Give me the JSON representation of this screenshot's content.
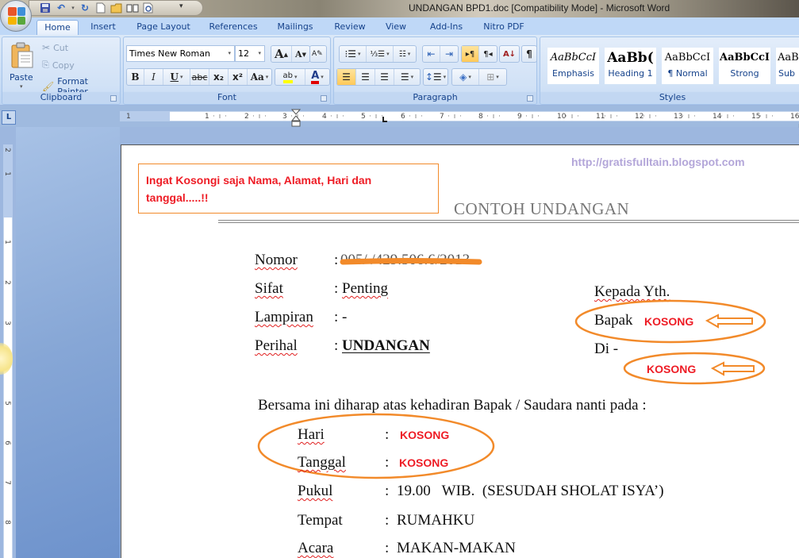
{
  "window": {
    "title": "UNDANGAN BPD1.doc [Compatibility Mode] - Microsoft Word"
  },
  "quick_access": {
    "icons": [
      "save-icon",
      "undo-icon",
      "redo-icon",
      "new-document-icon",
      "open-folder-icon",
      "open-book-icon",
      "print-preview-icon"
    ],
    "customize_label": "▾"
  },
  "tabs": [
    {
      "label": "Home",
      "active": true
    },
    {
      "label": "Insert"
    },
    {
      "label": "Page Layout"
    },
    {
      "label": "References"
    },
    {
      "label": "Mailings"
    },
    {
      "label": "Review"
    },
    {
      "label": "View"
    },
    {
      "label": "Add-Ins"
    },
    {
      "label": "Nitro PDF"
    }
  ],
  "ribbon": {
    "clipboard": {
      "label": "Clipboard",
      "paste": "Paste",
      "cut": "Cut",
      "copy": "Copy",
      "format_painter": "Format Painter"
    },
    "font": {
      "label": "Font",
      "font_name": "Times New Roman",
      "font_size": "12",
      "grow": "A",
      "shrink": "A",
      "bold": "B",
      "italic": "I",
      "underline": "U",
      "strikethrough": "abc",
      "subscript": "x₂",
      "superscript": "x²",
      "change_case": "Aa",
      "highlight": "ab",
      "font_color": "A",
      "highlight_color": "#ffff00",
      "font_color_value": "#e00000"
    },
    "paragraph": {
      "label": "Paragraph",
      "show_marks": "¶",
      "ltr": "▸¶",
      "rtl": "¶◂",
      "sort": "A↓"
    },
    "styles": {
      "label": "Styles",
      "items": [
        {
          "preview": "AaBbCcI",
          "name": "Emphasis"
        },
        {
          "preview": "AaBb(",
          "name": "Heading 1"
        },
        {
          "preview": "AaBbCcI",
          "name": "¶ Normal"
        },
        {
          "preview": "AaBbCcI",
          "name": "Strong"
        },
        {
          "preview": "AaB",
          "name": "Sub"
        }
      ]
    }
  },
  "ruler": {
    "corner": "L",
    "h_numbers": [
      "1",
      "1",
      "2",
      "3",
      "4",
      "5",
      "6",
      "7",
      "8",
      "9",
      "10",
      "11",
      "12",
      "13",
      "14",
      "15",
      "16"
    ],
    "v_numbers": [
      "2",
      "1",
      "1",
      "2",
      "3",
      "4",
      "5",
      "6",
      "7",
      "8"
    ]
  },
  "document": {
    "notice": "Ingat Kosongi saja Nama, Alamat, Hari dan tanggal.....!!",
    "url": "http://gratisfulltain.blogspot.com",
    "title": "CONTOH UNDANGAN",
    "header_fields": [
      {
        "label": "Nomor",
        "sep": ":",
        "value": "005/         /429.506.6/2013"
      },
      {
        "label": "Sifat",
        "sep": ":",
        "value": "Penting"
      },
      {
        "label": "Lampiran",
        "sep": ":",
        "value": "-"
      },
      {
        "label": "Perihal",
        "sep": ":",
        "value": "UNDANGAN"
      }
    ],
    "recipient": {
      "greeting": "Kepada Yth.",
      "bapak_label": "Bapak",
      "bapak_value": "KOSONG",
      "di_label": "Di  -",
      "di_value": "KOSONG"
    },
    "intro": "Bersama ini diharap atas kehadiran Bapak / Saudara  nanti pada :",
    "details": [
      {
        "label": "Hari",
        "sep": ":",
        "value": "KOSONG",
        "placeholder": true
      },
      {
        "label": "Tanggal",
        "sep": ":",
        "value": "KOSONG",
        "placeholder": true
      },
      {
        "label": "Pukul",
        "sep": ":",
        "value": "19.00   WIB.  (SESUDAH SHOLAT ISYA’)"
      },
      {
        "label": "Tempat",
        "sep": ":",
        "value": "RUMAHKU"
      },
      {
        "label": "Acara",
        "sep": ":",
        "value": "MAKAN-MAKAN"
      }
    ],
    "annotation_color": "#f28a2a",
    "placeholder_color": "#ee1c25"
  }
}
